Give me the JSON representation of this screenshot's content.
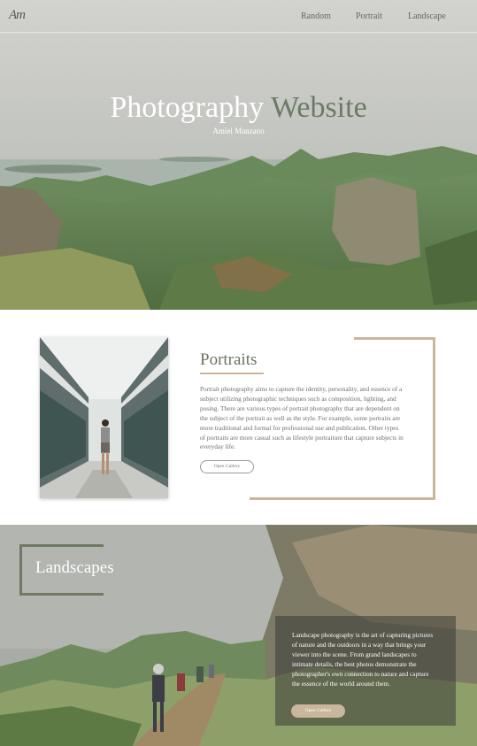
{
  "nav": {
    "logo": "Am",
    "links": [
      "Random",
      "Portrait",
      "Landscape"
    ]
  },
  "hero": {
    "title_part1": "Photography",
    "title_part2": "Website",
    "subtitle": "Amiel Manzano"
  },
  "portraits": {
    "title": "Portraits",
    "body": "Portrait photography aims to capture the identity, personality, and essence of a subject utilizing photographic techniques such as composition, lighting, and posing. There are various types of portrait photography that are dependent on the subject of the portrait as well as the style. For example, some portraits are more traditional and formal for professional use and publication. Other types of portraits are more casual such as lifestyle portraiture that capture subjects in everyday life.",
    "button": "Open Gallery"
  },
  "landscapes": {
    "title": "Landscapes",
    "body": "Landscape photography is the art of capturing pictures of nature and the outdoors in a way that brings your viewer into the scene. From grand landscapes to intimate details, the best photos demonstrate the photographer's own connection to nature and capture the essence of the world around them.",
    "button": "Open Gallery"
  },
  "colors": {
    "accent_tan": "#c9b69d",
    "accent_green": "#6f7a64"
  }
}
